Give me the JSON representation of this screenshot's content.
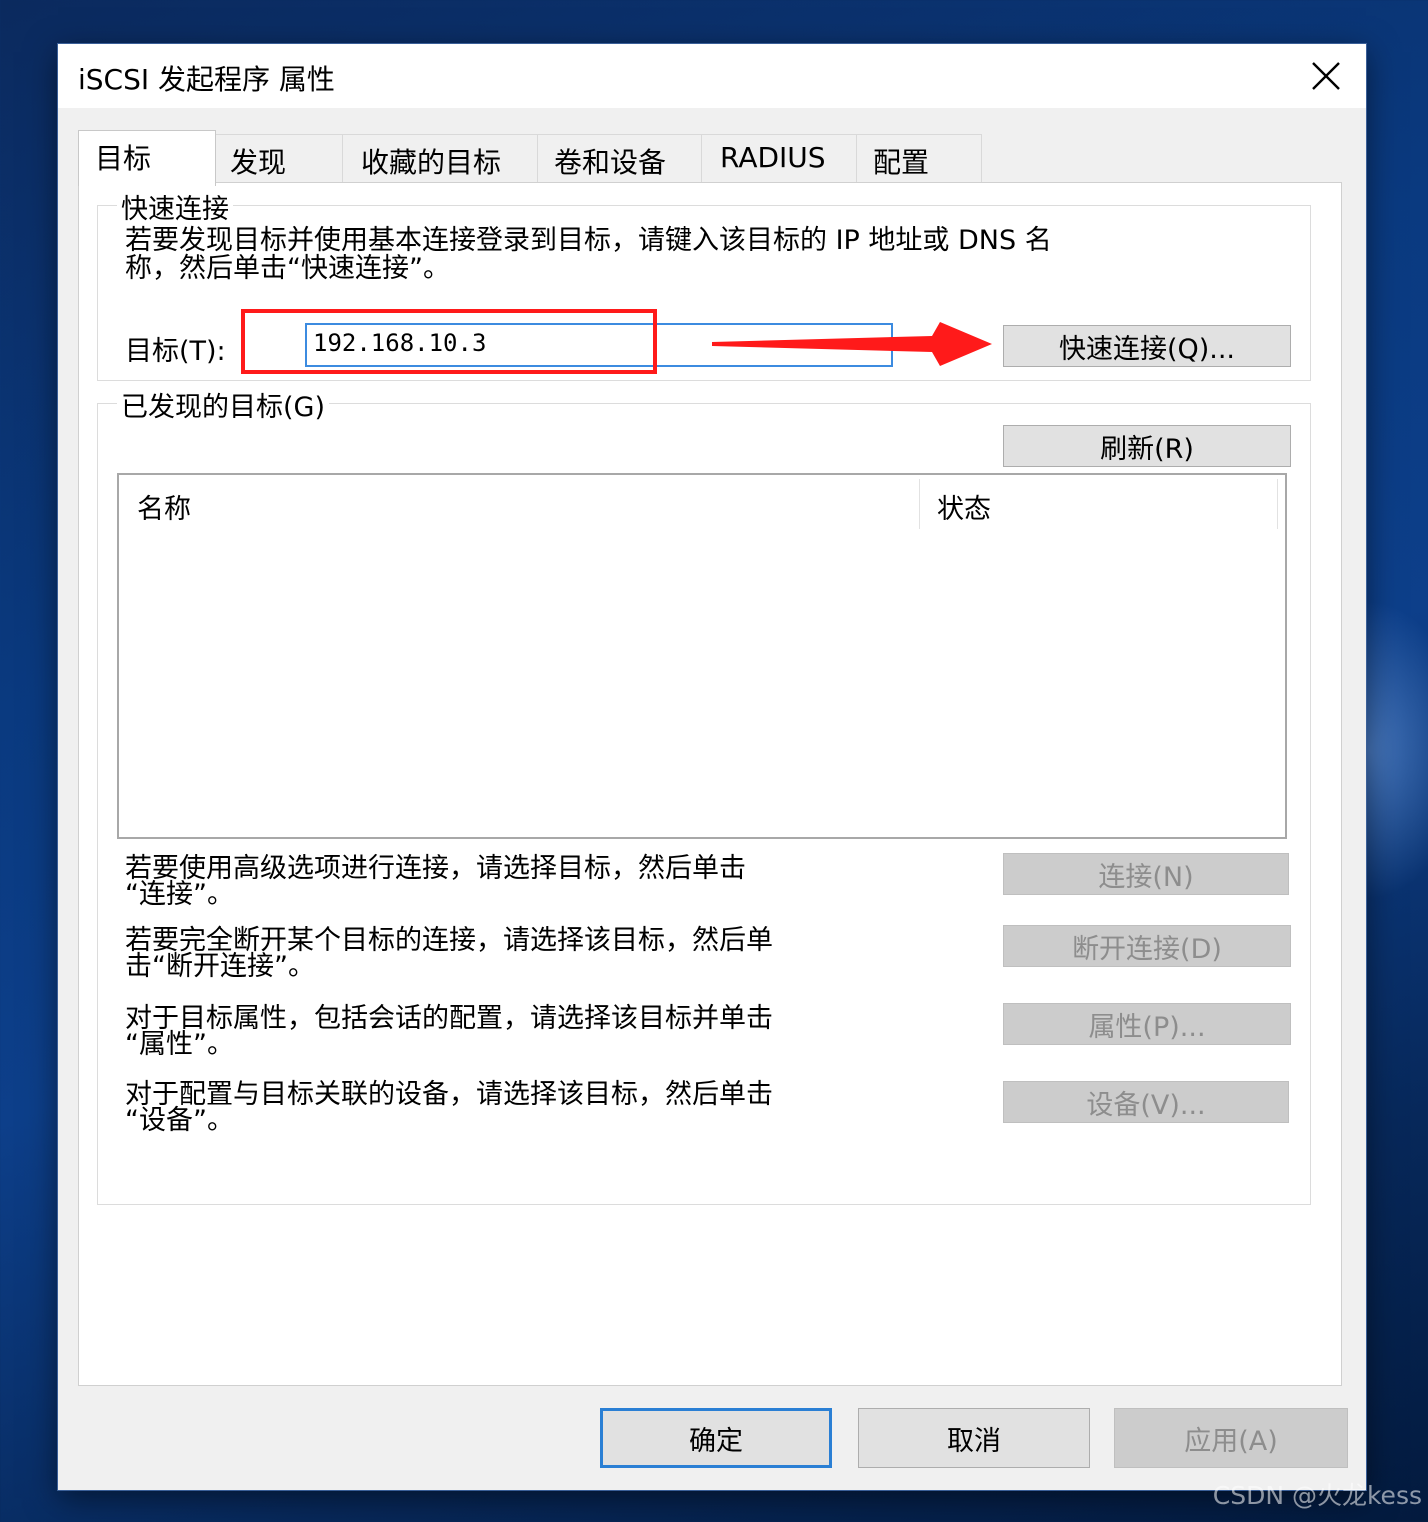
{
  "window": {
    "title": "iSCSI 发起程序 属性"
  },
  "tabs": [
    {
      "label": "目标",
      "active": true
    },
    {
      "label": "发现",
      "active": false
    },
    {
      "label": "收藏的目标",
      "active": false
    },
    {
      "label": "卷和设备",
      "active": false
    },
    {
      "label": "RADIUS",
      "active": false
    },
    {
      "label": "配置",
      "active": false
    }
  ],
  "quick_connect": {
    "group_title": "快速连接",
    "description_line1": "若要发现目标并使用基本连接登录到目标，请键入该目标的 IP 地址或 DNS 名",
    "description_line2": "称，然后单击“快速连接”。",
    "target_label": "目标(T):",
    "target_value": "192.168.10.3",
    "button_label": "快速连接(Q)..."
  },
  "discovered_targets": {
    "group_title": "已发现的目标(G)",
    "refresh_label": "刷新(R)",
    "columns": [
      "名称",
      "状态"
    ],
    "rows": []
  },
  "actions": [
    {
      "line1": "若要使用高级选项进行连接，请选择目标，然后单击",
      "line2": "“连接”。",
      "button": "连接(N)",
      "enabled": false
    },
    {
      "line1": "若要完全断开某个目标的连接，请选择该目标，然后单",
      "line2": "击“断开连接”。",
      "button": "断开连接(D)",
      "enabled": false
    },
    {
      "line1": "对于目标属性，包括会话的配置，请选择该目标并单击",
      "line2": "“属性”。",
      "button": "属性(P)...",
      "enabled": false
    },
    {
      "line1": "对于配置与目标关联的设备，请选择该目标，然后单击",
      "line2": "“设备”。",
      "button": "设备(V)...",
      "enabled": false
    }
  ],
  "footer": {
    "ok_label": "确定",
    "cancel_label": "取消",
    "apply_label": "应用(A)"
  },
  "annotation": {
    "highlight_color": "#ff1a1a"
  },
  "watermark": "CSDN @火龙kess"
}
